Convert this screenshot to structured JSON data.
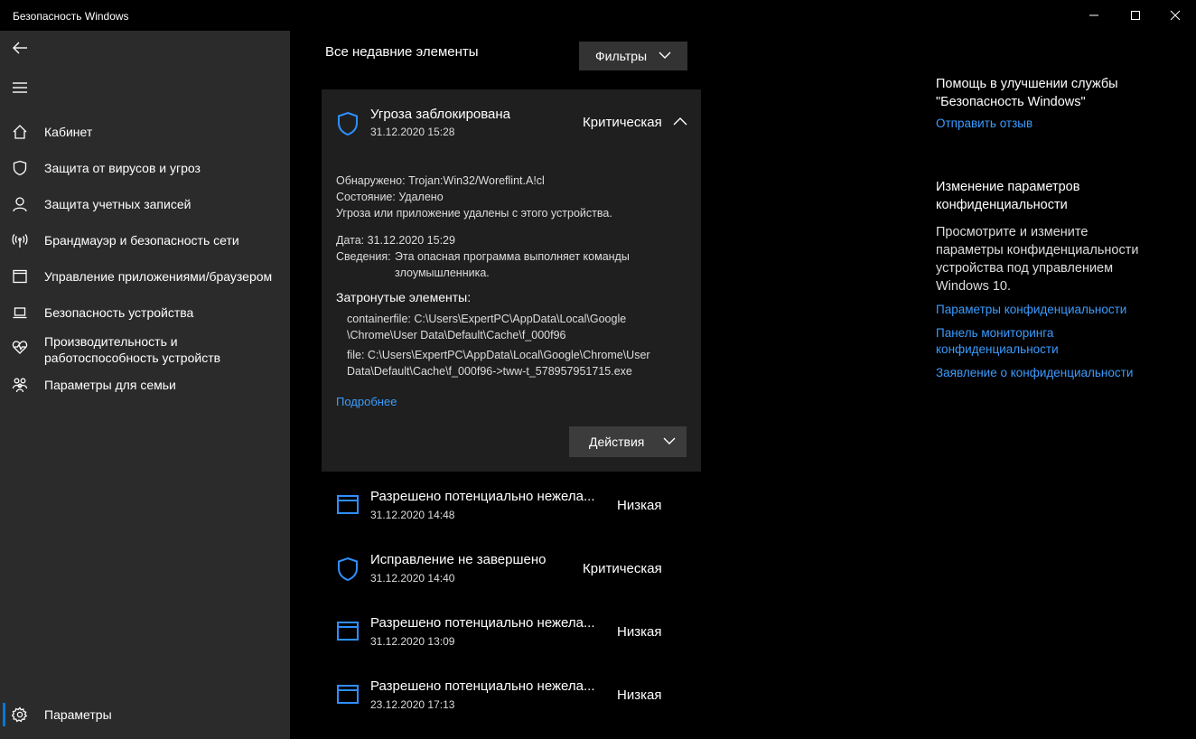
{
  "window": {
    "title": "Безопасность Windows",
    "controls": [
      "minimize-icon",
      "maximize-icon",
      "close-icon"
    ]
  },
  "sidebar": {
    "back_icon": "back-arrow-icon",
    "menu_icon": "hamburger-icon",
    "items": [
      {
        "label": "Кабинет",
        "icon": "home-icon"
      },
      {
        "label": "Защита от вирусов и угроз",
        "icon": "shield-icon"
      },
      {
        "label": "Защита учетных записей",
        "icon": "person-icon"
      },
      {
        "label": "Брандмауэр и безопасность сети",
        "icon": "antenna-icon"
      },
      {
        "label": "Управление приложениями/браузером",
        "icon": "app-window-icon"
      },
      {
        "label": "Безопасность устройства",
        "icon": "laptop-icon"
      },
      {
        "label": "Производительность и",
        "label2": "работоспособность устройств",
        "icon": "heart-pulse-icon"
      },
      {
        "label": "Параметры для семьи",
        "icon": "family-icon"
      }
    ],
    "settings": {
      "label": "Параметры",
      "icon": "gear-icon"
    }
  },
  "main": {
    "heading": "Все недавние элементы",
    "filter_label": "Фильтры",
    "expanded": {
      "title": "Угроза заблокирована",
      "date": "31.12.2020 15:28",
      "severity": "Критическая",
      "detected_label": "Обнаружено:",
      "detected_value": "Trojan:Win32/Woreflint.A!cl",
      "state_label": "Состояние:",
      "state_value": "Удалено",
      "removed_text": "Угроза или приложение удалены с этого устройства.",
      "date_label": "Дата:",
      "date_value": "31.12.2020 15:29",
      "details_label": "Сведения:",
      "details_line1": "Эта опасная программа выполняет команды",
      "details_line2": "злоумышленника.",
      "affected_heading": "Затронутые элементы:",
      "affected_1a": "containerfile: C:\\Users\\ExpertPC\\AppData\\Local\\Google",
      "affected_1b": "\\Chrome\\User Data\\Default\\Cache\\f_000f96",
      "affected_2a": "file: C:\\Users\\ExpertPC\\AppData\\Local\\Google\\Chrome\\User",
      "affected_2b": "Data\\Default\\Cache\\f_000f96->tww-t_578957951715.exe",
      "more_link": "Подробнее",
      "actions_label": "Действия"
    },
    "items": [
      {
        "title": "Разрешено потенциально нежела...",
        "date": "31.12.2020 14:48",
        "severity": "Низкая",
        "icon": "app-window-icon"
      },
      {
        "title": "Исправление не завершено",
        "date": "31.12.2020 14:40",
        "severity": "Критическая",
        "icon": "shield-icon"
      },
      {
        "title": "Разрешено потенциально нежела...",
        "date": "31.12.2020 13:09",
        "severity": "Низкая",
        "icon": "app-window-icon"
      },
      {
        "title": "Разрешено потенциально нежела...",
        "date": "23.12.2020 17:13",
        "severity": "Низкая",
        "icon": "app-window-icon"
      }
    ]
  },
  "right_panel": {
    "help_title_1": "Помощь в улучшении службы",
    "help_title_2": "\"Безопасность Windows\"",
    "feedback_link": "Отправить отзыв",
    "privacy_title_1": "Изменение параметров",
    "privacy_title_2": "конфиденциальности",
    "privacy_desc_1": "Просмотрите и измените",
    "privacy_desc_2": "параметры конфиденциальности",
    "privacy_desc_3": "устройства под управлением",
    "privacy_desc_4": "Windows 10.",
    "link_settings": "Параметры конфиденциальности",
    "link_dashboard_1": "Панель мониторинга",
    "link_dashboard_2": "конфиденциальности",
    "link_statement": "Заявление о конфиденциальности"
  },
  "colors": {
    "accent": "#0078d7",
    "link": "#3b9cff",
    "sidebar": "#2b2b2b",
    "card": "#1f1f1f"
  }
}
